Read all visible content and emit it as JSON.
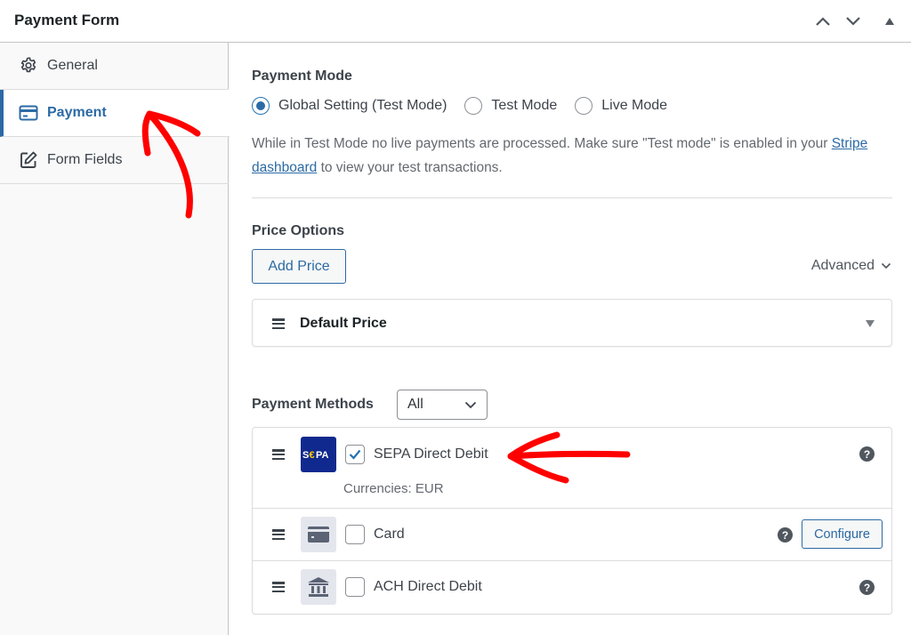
{
  "header": {
    "title": "Payment Form",
    "icons": [
      "chevron-up-icon",
      "chevron-down-icon",
      "triangle-up-icon"
    ]
  },
  "sidebar": {
    "tabs": [
      {
        "label": "General",
        "icon": "gear-icon",
        "active": false
      },
      {
        "label": "Payment",
        "icon": "credit-card-icon",
        "active": true
      },
      {
        "label": "Form Fields",
        "icon": "edit-icon",
        "active": false
      }
    ]
  },
  "payment_mode": {
    "title": "Payment Mode",
    "options": [
      {
        "label": "Global Setting (Test Mode)",
        "checked": true
      },
      {
        "label": "Test Mode",
        "checked": false
      },
      {
        "label": "Live Mode",
        "checked": false
      }
    ],
    "help_before": "While in Test Mode no live payments are processed. Make sure \"Test mode\" is enabled in your ",
    "help_link": "Stripe dashboard",
    "help_after": " to view your test transactions."
  },
  "price_options": {
    "title": "Price Options",
    "add_price_label": "Add Price",
    "advanced_label": "Advanced",
    "prices": [
      {
        "label": "Default Price"
      }
    ]
  },
  "payment_methods": {
    "title": "Payment Methods",
    "filter_value": "All",
    "methods": [
      {
        "name": "SEPA Direct Debit",
        "checked": true,
        "logo": "SEPA",
        "currencies": "Currencies: EUR",
        "icon": "sepa-logo"
      },
      {
        "name": "Card",
        "checked": false,
        "icon": "credit-card-icon",
        "configure_label": "Configure"
      },
      {
        "name": "ACH Direct Debit",
        "checked": false,
        "icon": "bank-icon"
      }
    ]
  },
  "colors": {
    "accent": "#2c6aa5",
    "annotation": "#ff0000",
    "sepa_bg": "#10298e",
    "sepa_euro": "#ffcc00"
  }
}
